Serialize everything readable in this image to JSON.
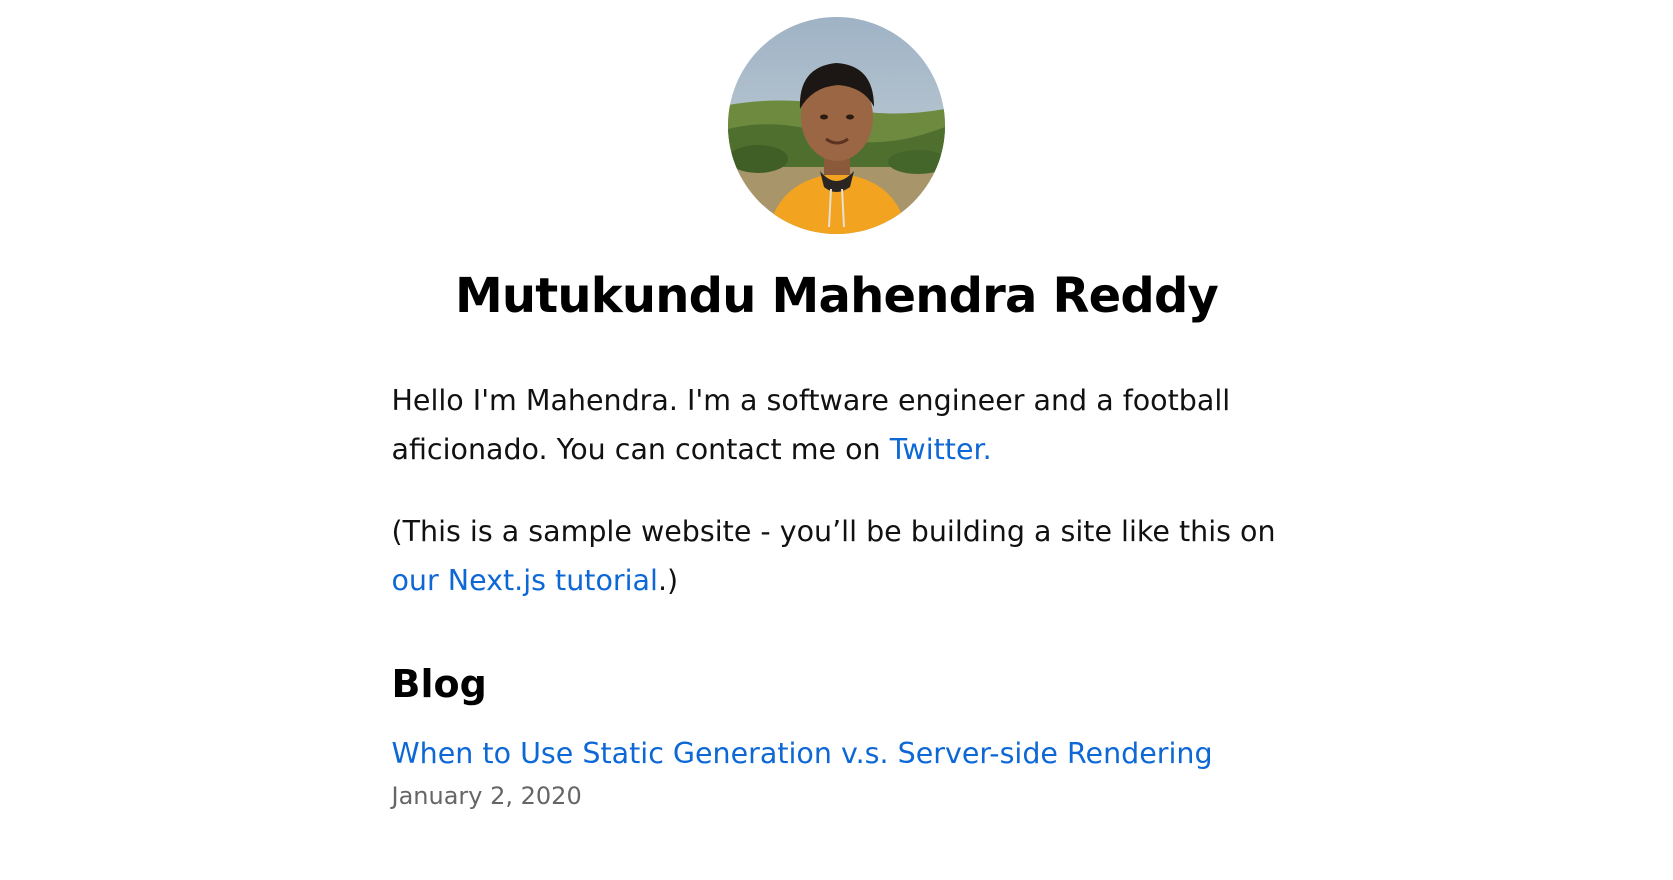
{
  "profile": {
    "name": "Mutukundu Mahendra Reddy",
    "avatar_icon": "profile-photo"
  },
  "intro": {
    "line1_text": "Hello I'm Mahendra. I'm a software engineer and a football aficionado. You can contact me on ",
    "twitter_link": "Twitter.",
    "note_prefix": "(This is a sample website - you’ll be building a site like this on ",
    "tutorial_link": "our Next.js tutorial",
    "note_suffix": ".)"
  },
  "blog": {
    "heading": "Blog",
    "posts": [
      {
        "title": "When to Use Static Generation v.s. Server-side Rendering",
        "date": "January 2, 2020"
      }
    ]
  },
  "colors": {
    "link": "#0d68d6",
    "text": "#111111",
    "date": "#666666",
    "hoodie": "#f2a31f"
  }
}
